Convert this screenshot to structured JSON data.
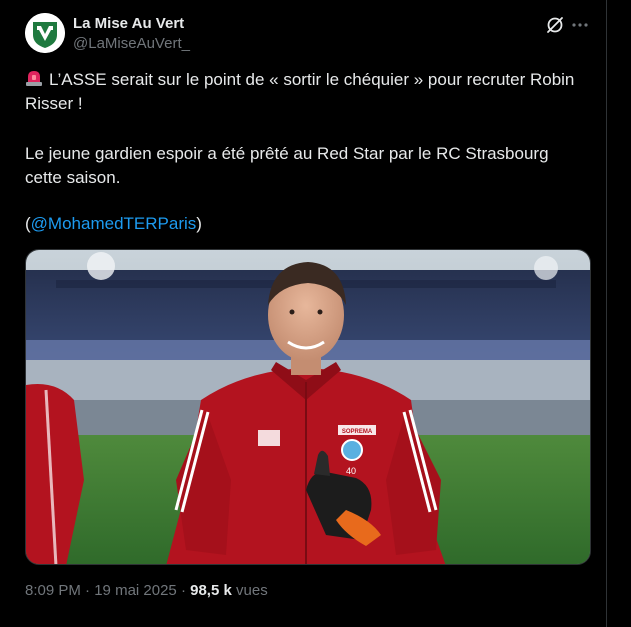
{
  "tweet": {
    "author_name": "La Mise Au Vert",
    "author_handle": "@LaMiseAuVert_",
    "line1": "L’ASSE serait sur le point de « sortir le chéquier » pour recruter Robin",
    "line2": "Risser !",
    "line3": "Le jeune gardien espoir a été prêté au Red Star par le RC Strasbourg",
    "line4": "cette saison.",
    "mention_open": "(",
    "mention": "@MohamedTERParis",
    "mention_close": ")",
    "time": "8:09 PM",
    "separator": "·",
    "date": "19 mai 2025",
    "views_count": "98,5 k",
    "views_label": "vues",
    "jersey_brand": "SOPREMA",
    "jersey_number": "40"
  },
  "colors": {
    "background": "#000000",
    "text": "#e7e9ea",
    "muted": "#71767b",
    "link": "#1d9bf0",
    "jersey_red": "#b3131f"
  },
  "icons": [
    "siren-emoji-icon",
    "grok-icon",
    "more-icon"
  ]
}
